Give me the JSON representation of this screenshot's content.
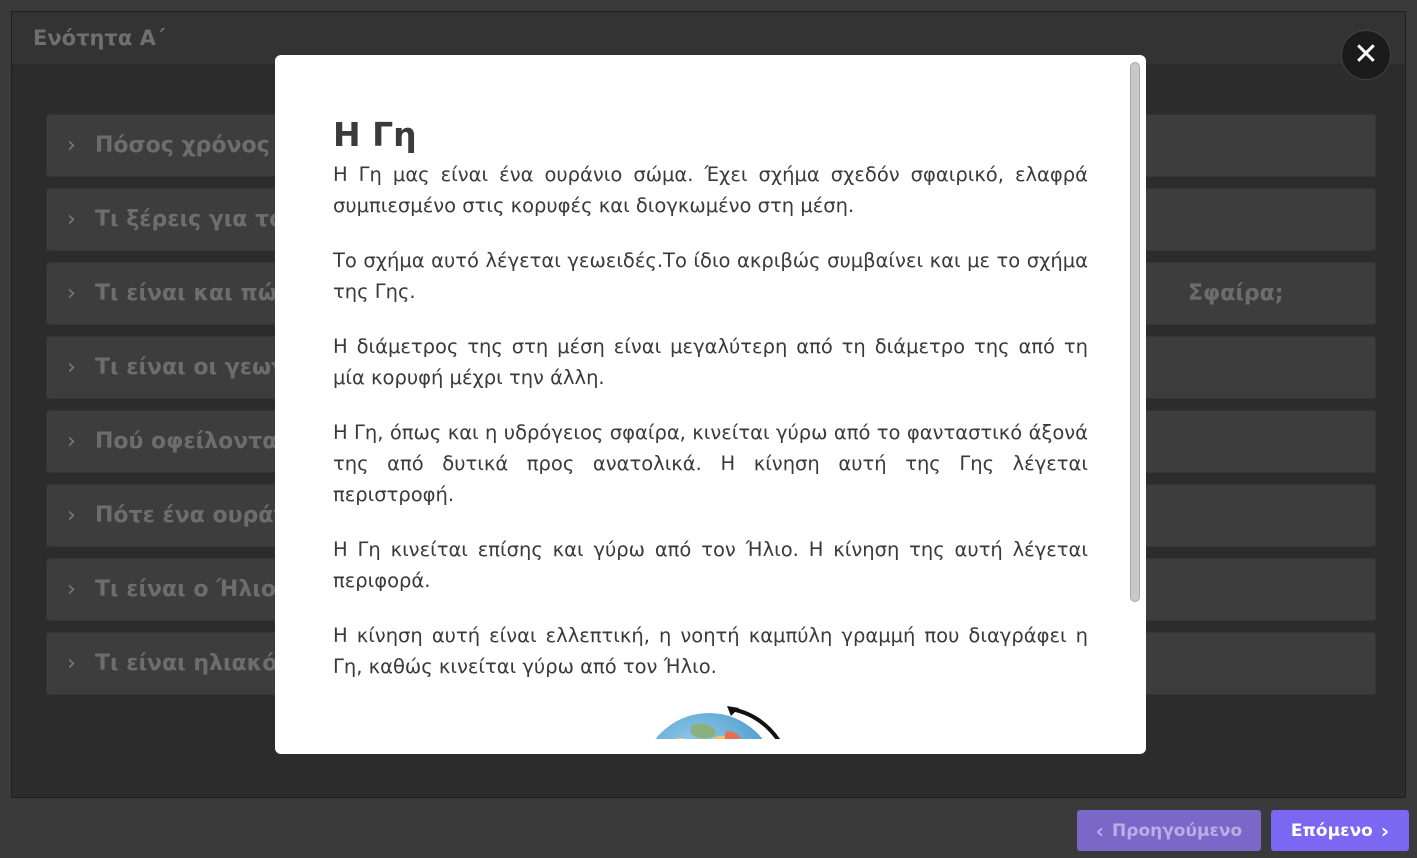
{
  "section": {
    "title": "Ενότητα Α΄"
  },
  "accordion": {
    "items": [
      {
        "label": "Πόσος χρόνος χ",
        "tail": ""
      },
      {
        "label": "Τι ξέρεις για το",
        "tail": ""
      },
      {
        "label": "Τι είναι και πώς",
        "tail": "Σφαίρα;"
      },
      {
        "label": "Τι είναι οι γεωγ",
        "tail": ""
      },
      {
        "label": "Πού οφείλοντα",
        "tail": ""
      },
      {
        "label": "Πότε ένα ουράν",
        "tail": ""
      },
      {
        "label": "Τι είναι ο Ήλιος",
        "tail": ""
      },
      {
        "label": "Τι είναι ηλιακό",
        "tail": ""
      }
    ],
    "chevron": "chevron-right-icon"
  },
  "modal": {
    "title": "Η Γη",
    "paragraphs": [
      "Η Γη μας είναι ένα ουράνιο σώμα. Έχει σχήμα σχεδόν σφαιρικό, ελαφρά συμπιεσμένο στις κορυφές και διογκωμένο στη μέση.",
      "Το σχήμα αυτό λέγεται γεωειδές.Το ίδιο ακριβώς συμβαίνει και με το σχήμα της Γης.",
      "Η διάμετρος της στη μέση είναι μεγαλύτερη από τη διάμετρο της από τη μία κορυφή μέχρι την άλλη.",
      "Η Γη, όπως και η υδρόγειος σφαίρα, κινείται γύρω από το φανταστικό άξονά της από δυτικά προς ανατολικά. Η κίνηση αυτή της Γης λέγεται περιστροφή.",
      "Η Γη κινείται επίσης και γύρω από τον Ήλιο. Η κίνηση της αυτή λέγεται περιφορά.",
      "Η κίνηση αυτή είναι ελλεπτική, η νοητή καμπύλη γραμμή που διαγράφει η Γη, καθώς κινείται γύρω από τον Ήλιο."
    ],
    "close_symbol": "✕",
    "image_icon": "globe-icon"
  },
  "footer": {
    "prev_label": "Προηγούμενο",
    "next_label": "Επόμενο",
    "prev_chevron": "‹",
    "next_chevron": "›"
  },
  "colors": {
    "accent": "#7b67f2",
    "accent_disabled": "#7b67c7",
    "backdrop": "#2c2c2c"
  }
}
